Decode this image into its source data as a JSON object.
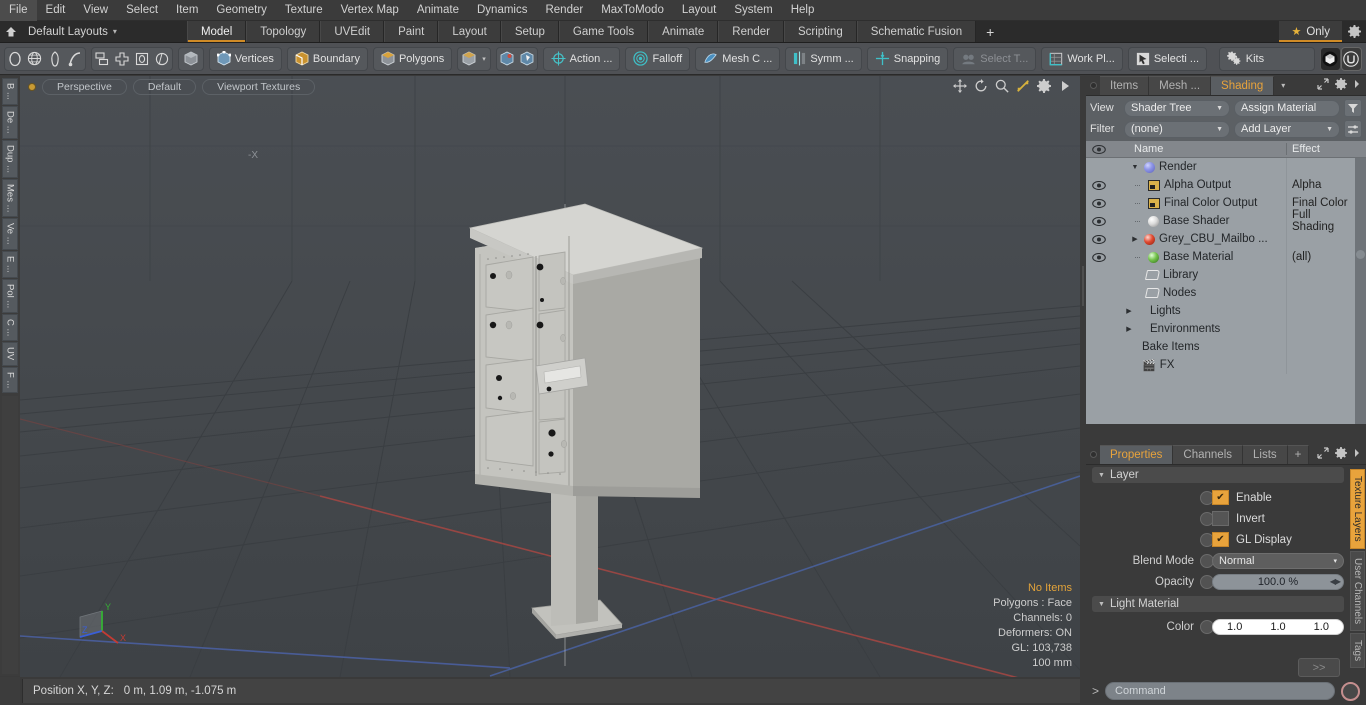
{
  "menu": {
    "items": [
      "File",
      "Edit",
      "View",
      "Select",
      "Item",
      "Geometry",
      "Texture",
      "Vertex Map",
      "Animate",
      "Dynamics",
      "Render",
      "MaxToModo",
      "Layout",
      "System",
      "Help"
    ]
  },
  "layout_bar": {
    "home_icon": "home-icon",
    "layout_name": "Default Layouts",
    "caret": "▾",
    "tabs": [
      {
        "label": "Model",
        "active": true
      },
      {
        "label": "Topology",
        "active": false
      },
      {
        "label": "UVEdit",
        "active": false
      },
      {
        "label": "Paint",
        "active": false
      },
      {
        "label": "Layout",
        "active": false
      },
      {
        "label": "Setup",
        "active": false
      },
      {
        "label": "Game Tools",
        "active": false
      },
      {
        "label": "Animate",
        "active": false
      },
      {
        "label": "Render",
        "active": false
      },
      {
        "label": "Scripting",
        "active": false
      },
      {
        "label": "Schematic Fusion",
        "active": false
      }
    ],
    "add_tab": "+",
    "only_label": "Only",
    "star_glyph": "★",
    "gear_glyph": "⚙"
  },
  "toolbar": {
    "shape_icons": [
      "ellipse-icon",
      "globe-icon",
      "pen-icon",
      "curve-icon"
    ],
    "mode_icons": [
      "duplicate-icon",
      "crosshair-icon",
      "square-target-icon",
      "circle-target-icon"
    ],
    "cube_icon": "cube-icon",
    "buttons": [
      {
        "label": "Vertices",
        "icon": "vertices-icon",
        "dim": false
      },
      {
        "label": "Boundary",
        "icon": "boundary-icon",
        "dim": false
      },
      {
        "label": "Polygons",
        "icon": "polygons-icon",
        "dim": false
      }
    ],
    "element_dropdown": {
      "icon": "cube-icon",
      "caret": "▾"
    },
    "paint_icons": [
      "select-mode-a-icon",
      "select-mode-b-icon"
    ],
    "right_buttons": [
      {
        "label": "Action  ...",
        "icon": "action-center-icon",
        "dim": false
      },
      {
        "label": "Falloff",
        "icon": "falloff-icon",
        "dim": false
      },
      {
        "label": "Mesh C ...",
        "icon": "mesh-constraint-icon",
        "dim": false
      },
      {
        "label": "Symm ...",
        "icon": "symmetry-icon",
        "dim": false
      },
      {
        "label": "Snapping",
        "icon": "snapping-icon",
        "dim": false
      },
      {
        "label": "Select T...",
        "icon": "select-through-icon",
        "dim": true
      },
      {
        "label": "Work Pl...",
        "icon": "work-plane-icon",
        "dim": false
      },
      {
        "label": "Selecti ...",
        "icon": "selection-set-icon",
        "dim": false
      },
      {
        "label": "Kits",
        "icon": "kits-gears-icon",
        "dim": false
      }
    ],
    "app_icons": [
      "substance-icon",
      "unreal-icon"
    ]
  },
  "left_toolbar": {
    "tabs": [
      "B ...",
      "De ...",
      "Dup ...",
      "Mes ...",
      "Ve ...",
      "E ...",
      "Pol ...",
      "C ...",
      "UV",
      "F ..."
    ]
  },
  "viewport": {
    "indicator_dot_color": "#c89a34",
    "pills": [
      "Perspective",
      "Default",
      "Viewport Textures"
    ],
    "controls": [
      "pan-icon",
      "rotate-icon",
      "zoom-icon",
      "fit-icon",
      "viewport-settings-icon",
      "play-icon"
    ],
    "info": {
      "selection": "No Items",
      "lines": [
        "Polygons : Face",
        "Channels: 0",
        "Deformers: ON",
        "GL: 103,738",
        "100 mm"
      ]
    },
    "axis_gizmo": {
      "x": "X",
      "y": "Y",
      "z": "Z",
      "x_color": "#cc3333",
      "y_color": "#33bb33",
      "z_color": "#3355dd"
    },
    "background_color": "#45494d",
    "grid_color": "#3c4044"
  },
  "status_bar": {
    "position_label": "Position X, Y, Z:",
    "position_value": "0 m, 1.09 m, -1.075 m"
  },
  "shading_panel": {
    "tabs": [
      {
        "label": "Items",
        "active": false
      },
      {
        "label": "Mesh ...",
        "active": false
      },
      {
        "label": "Shading",
        "active": true
      }
    ],
    "tab_caret": "▾",
    "header_icons": [
      "expand-icon",
      "gear-icon",
      "chevron-right-icon"
    ],
    "controls": [
      {
        "label": "View",
        "value": "Shader Tree",
        "button": "Assign Material",
        "side_icon": "filter-funnel-icon"
      },
      {
        "label": "Filter",
        "value": "(none)",
        "button": "Add Layer",
        "side_icon": "list-options-icon"
      }
    ],
    "columns": {
      "eye": "eye-icon",
      "name": "Name",
      "effect": "Effect"
    },
    "rows": [
      {
        "eye": false,
        "indent": 0,
        "twisty": "▼",
        "icon": "sphere-blue",
        "name": "Render",
        "effect": "",
        "caret": false
      },
      {
        "eye": true,
        "indent": 1,
        "twisty": "",
        "icon": "image",
        "name": "Alpha Output",
        "effect": "Alpha",
        "caret": true
      },
      {
        "eye": true,
        "indent": 1,
        "twisty": "",
        "icon": "image",
        "name": "Final Color Output",
        "effect": "Final Color",
        "caret": true
      },
      {
        "eye": true,
        "indent": 1,
        "twisty": "",
        "icon": "sphere-white",
        "name": "Base Shader",
        "effect": "Full Shading",
        "caret": true
      },
      {
        "eye": true,
        "indent": 1,
        "twisty": "▶",
        "icon": "sphere-red",
        "name": "Grey_CBU_Mailbo ...",
        "effect": "",
        "caret": true
      },
      {
        "eye": true,
        "indent": 1,
        "twisty": "",
        "icon": "sphere-green",
        "name": "Base Material",
        "effect": "(all)",
        "caret": true
      },
      {
        "eye": false,
        "indent": 1,
        "twisty": "",
        "icon": "folder",
        "name": "Library",
        "effect": "",
        "caret": false
      },
      {
        "eye": false,
        "indent": 1,
        "twisty": "",
        "icon": "folder",
        "name": "Nodes",
        "effect": "",
        "caret": false
      },
      {
        "eye": false,
        "indent": 0,
        "twisty": "▶",
        "icon": "none",
        "name": "Lights",
        "effect": "",
        "caret": false
      },
      {
        "eye": false,
        "indent": 0,
        "twisty": "▶",
        "icon": "none",
        "name": "Environments",
        "effect": "",
        "caret": false
      },
      {
        "eye": false,
        "indent": 0,
        "twisty": "",
        "icon": "none",
        "name": "Bake Items",
        "effect": "",
        "caret": false
      },
      {
        "eye": false,
        "indent": 0,
        "twisty": "",
        "icon": "fx",
        "name": "FX",
        "effect": "",
        "caret": false
      }
    ]
  },
  "properties_panel": {
    "tabs": [
      {
        "label": "Properties",
        "active": true
      },
      {
        "label": "Channels",
        "active": false
      },
      {
        "label": "Lists",
        "active": false
      },
      {
        "label": "+",
        "active": false
      }
    ],
    "header_icons": [
      "expand-icon",
      "gear-icon",
      "chevron-right-icon"
    ],
    "sections": [
      {
        "title": "Layer",
        "twisty": "▼",
        "fields": [
          {
            "type": "checkbox",
            "label": "Enable",
            "checked": true,
            "check_glyph": "✔"
          },
          {
            "type": "checkbox",
            "label": "Invert",
            "checked": false,
            "check_glyph": ""
          },
          {
            "type": "checkbox",
            "label": "GL Display",
            "checked": true,
            "check_glyph": "✔"
          },
          {
            "type": "dropdown",
            "label": "Blend Mode",
            "value": "Normal",
            "caret": "▾"
          },
          {
            "type": "number",
            "label": "Opacity",
            "value": "100.0 %",
            "spinner": "◀▶"
          }
        ]
      },
      {
        "title": "Light Material",
        "twisty": "▼",
        "fields": [
          {
            "type": "color",
            "label": "Color",
            "values": [
              "1.0",
              "1.0",
              "1.0"
            ]
          }
        ]
      }
    ],
    "more_button": ">>",
    "side_tabs": [
      {
        "label": "Texture Layers",
        "active": true
      },
      {
        "label": "User Channels",
        "active": false
      },
      {
        "label": "Tags",
        "active": false
      }
    ]
  },
  "command_bar": {
    "prompt": ">",
    "placeholder": "Command",
    "record_icon": "record-icon"
  },
  "colors": {
    "accent": "#e8a33c",
    "panel_bg": "#3a3a3a",
    "toolbar_bg": "#4f5155",
    "tree_bg": "#9aa0a5",
    "viewport_bg": "#45494d"
  }
}
